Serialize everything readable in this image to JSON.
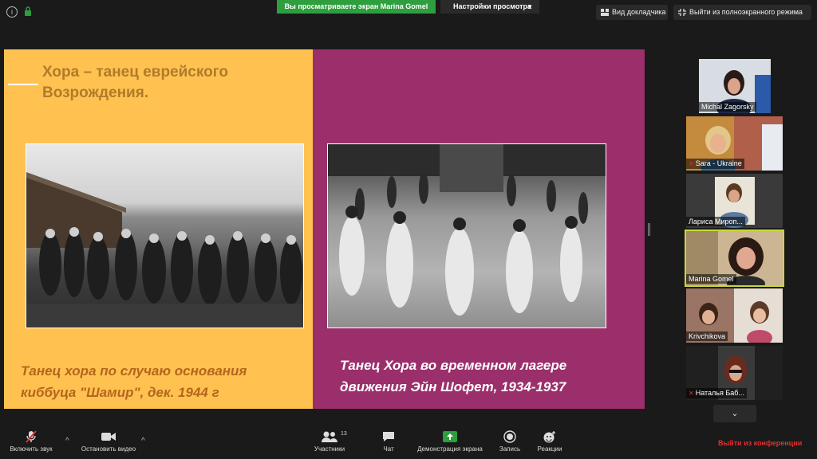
{
  "top": {
    "share_banner": "Вы просматриваете экран Marina Gomel",
    "view_settings": "Настройки просмотра",
    "side_by_side": "Вид докладчика",
    "exit_fullscreen": "Выйти из полноэкранного режима"
  },
  "slide": {
    "title_line1": "Хора – танец еврейского",
    "title_line2": "Возрождения.",
    "caption_left_line1": "Танец хора по случаю основания",
    "caption_left_line2": "киббуца \"Шамир\", дек. 1944 г",
    "caption_right_line1": "Танец Хора во временном лагере",
    "caption_right_line2": "движения Эйн Шофет, 1934-1937"
  },
  "participants": [
    {
      "name": "Michal Zagorsky",
      "muted": false
    },
    {
      "name": "Sara - Ukraine",
      "muted": true
    },
    {
      "name": "Лариса Мироп...",
      "muted": false
    },
    {
      "name": "Marina Gomel",
      "muted": false,
      "active": true
    },
    {
      "name": "Krivchikova",
      "muted": false
    },
    {
      "name": "Наталья Баб...",
      "muted": true
    }
  ],
  "toolbar": {
    "audio": "Включить звук",
    "video": "Остановить видео",
    "participants": "Участники",
    "participants_count": "13",
    "chat": "Чат",
    "share": "Демонстрация экрана",
    "record": "Запись",
    "reactions": "Реакции",
    "leave": "Выйти из конференции"
  },
  "colors": {
    "share_green": "#2e9e3e",
    "slide_left": "#ffc250",
    "slide_right": "#9b2f6b",
    "leave_red": "#e03030",
    "active_speaker": "#c8d83a"
  }
}
